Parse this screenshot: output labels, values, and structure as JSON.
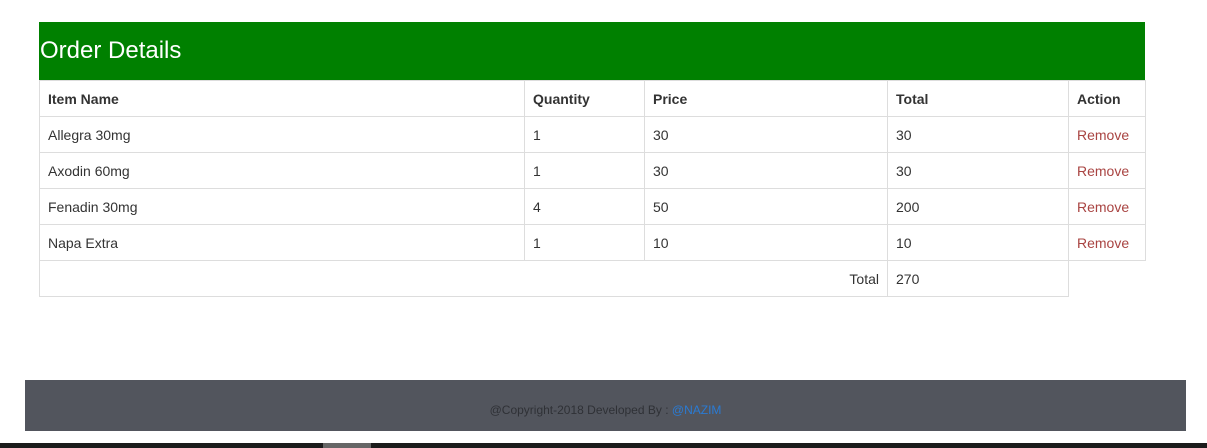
{
  "panel": {
    "title": "Order Details"
  },
  "table": {
    "headers": [
      "Item Name",
      "Quantity",
      "Price",
      "Total",
      "Action"
    ],
    "rows": [
      {
        "item": "Allegra 30mg",
        "quantity": "1",
        "price": "30",
        "total": "30",
        "action": "Remove"
      },
      {
        "item": "Axodin 60mg",
        "quantity": "1",
        "price": "30",
        "total": "30",
        "action": "Remove"
      },
      {
        "item": "Fenadin 30mg",
        "quantity": "4",
        "price": "50",
        "total": "200",
        "action": "Remove"
      },
      {
        "item": "Napa Extra",
        "quantity": "1",
        "price": "10",
        "total": "10",
        "action": "Remove"
      }
    ],
    "grand_total_label": "Total",
    "grand_total_value": "270"
  },
  "footer": {
    "text": "@Copyright-2018 Developed By :",
    "link": "@NAZIM"
  },
  "colors": {
    "header_bg": "#008000",
    "remove_link": "#a94442",
    "footer_bg": "#52555d",
    "footer_link": "#2a7bd4"
  }
}
